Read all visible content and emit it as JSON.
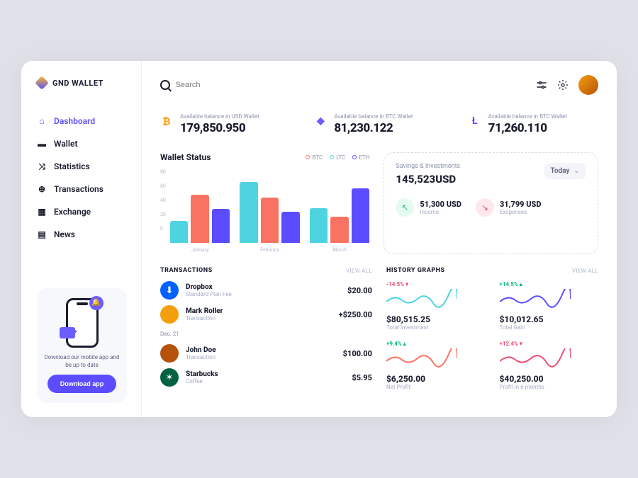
{
  "brand": "GND WALLET",
  "search": {
    "placeholder": "Search"
  },
  "sidebar": {
    "items": [
      {
        "label": "Dashboard",
        "icon": "home"
      },
      {
        "label": "Wallet",
        "icon": "wallet"
      },
      {
        "label": "Statistics",
        "icon": "shuffle"
      },
      {
        "label": "Transactions",
        "icon": "globe"
      },
      {
        "label": "Exchange",
        "icon": "store"
      },
      {
        "label": "News",
        "icon": "news"
      }
    ],
    "promo": {
      "text": "Download our mobile app and be up to date",
      "button": "Download app"
    }
  },
  "balances": [
    {
      "label": "Available balance in USD Wallet",
      "value": "179,850.950",
      "coin": "btc"
    },
    {
      "label": "Available balance in BTC Wallet",
      "value": "81,230.122",
      "coin": "eth"
    },
    {
      "label": "Available balance in BTC Wallet",
      "value": "71,260.110",
      "coin": "ltc"
    }
  ],
  "walletStatus": {
    "title": "Wallet Status",
    "legend": [
      "BTC",
      "LTC",
      "ETH"
    ]
  },
  "savings": {
    "label": "Savings & Investments",
    "value": "145,523USD",
    "select": "Today",
    "income": {
      "value": "51,300 USD",
      "label": "Income"
    },
    "expenses": {
      "value": "31,799 USD",
      "label": "Excpenses"
    }
  },
  "transactions": {
    "title": "TRANSACTIONS",
    "viewAll": "VIEW ALL",
    "date": "Dec. 21",
    "items": [
      {
        "name": "Dropbox",
        "sub": "Standard Plan Fee",
        "amount": "$20.00",
        "color": "#0061ff"
      },
      {
        "name": "Mark Roller",
        "sub": "Transaction",
        "amount": "+$250.00",
        "color": "#f59e0b"
      },
      {
        "name": "John Doe",
        "sub": "Transaction",
        "amount": "$100.00",
        "color": "#b45309"
      },
      {
        "name": "Starbucks",
        "sub": "Coffee",
        "amount": "$5.95",
        "color": "#006241"
      }
    ]
  },
  "history": {
    "title": "HISTORY GRAPHS",
    "viewAll": "VIEW ALL",
    "items": [
      {
        "change": "-14.5%",
        "dir": "neg",
        "value": "$80,515.25",
        "label": "Total Investment",
        "color": "#4dd4e0"
      },
      {
        "change": "+14.5%",
        "dir": "pos",
        "value": "$10,012.65",
        "label": "Total Gain",
        "color": "#5b4dff"
      },
      {
        "change": "+9.4%",
        "dir": "pos",
        "value": "$6,250.00",
        "label": "Net Profit",
        "color": "#f97362"
      },
      {
        "change": "+12.4%",
        "dir": "neg",
        "value": "$40,250.00",
        "label": "Profit in 6 months",
        "color": "#ef4e75"
      }
    ]
  },
  "chart_data": {
    "type": "bar",
    "title": "Wallet Status",
    "categories": [
      "January",
      "Feburary",
      "March"
    ],
    "series": [
      {
        "name": "BTC",
        "values": [
          28,
          78,
          45
        ]
      },
      {
        "name": "LTC",
        "values": [
          62,
          58,
          34
        ]
      },
      {
        "name": "ETH",
        "values": [
          44,
          40,
          70
        ]
      }
    ],
    "ylim": [
      0,
      80
    ],
    "yticks": [
      0,
      20,
      40,
      60,
      80
    ]
  }
}
